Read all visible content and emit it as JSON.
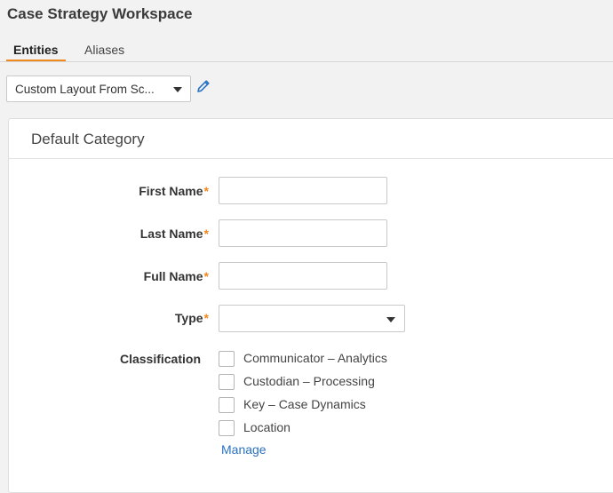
{
  "page": {
    "title": "Case Strategy Workspace"
  },
  "tabs": [
    {
      "label": "Entities",
      "active": true
    },
    {
      "label": "Aliases",
      "active": false
    }
  ],
  "layout_select": {
    "value": "Custom Layout From Sc..."
  },
  "edit_icon": "pencil-icon",
  "category": {
    "title": "Default Category"
  },
  "form": {
    "required_marker": "*",
    "first_name": {
      "label": "First Name",
      "value": ""
    },
    "last_name": {
      "label": "Last Name",
      "value": ""
    },
    "full_name": {
      "label": "Full Name",
      "value": ""
    },
    "type": {
      "label": "Type",
      "value": ""
    },
    "classification": {
      "label": "Classification",
      "options": [
        {
          "label": "Communicator – Analytics",
          "checked": false
        },
        {
          "label": "Custodian – Processing",
          "checked": false
        },
        {
          "label": "Key – Case Dynamics",
          "checked": false
        },
        {
          "label": "Location",
          "checked": false
        }
      ],
      "manage_label": "Manage"
    }
  },
  "colors": {
    "accent": "#f0891e",
    "link": "#2a72c0",
    "icon": "#2a72c0"
  }
}
